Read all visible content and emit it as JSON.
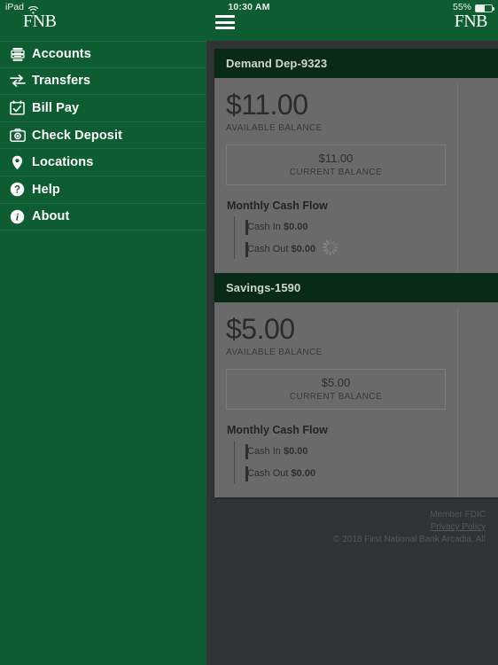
{
  "status_bar": {
    "device": "iPad",
    "wifi_icon": "wifi-icon",
    "time": "10:30 AM",
    "battery_percent": "55%",
    "battery_icon": "battery-icon"
  },
  "brand": {
    "logo_text": "FNB",
    "primary_green": "#0d5c32",
    "header_dark_green": "#0a2a19",
    "page_background": "#323335",
    "card_background": "#6a6a6a"
  },
  "nav": {
    "menu_icon": "hamburger-menu-icon",
    "logo_text": "FNB"
  },
  "drawer": {
    "logo_text": "FNB",
    "items": [
      {
        "label": "Accounts",
        "icon": "accounts-icon"
      },
      {
        "label": "Transfers",
        "icon": "transfers-icon"
      },
      {
        "label": "Bill Pay",
        "icon": "bill-pay-icon"
      },
      {
        "label": "Check Deposit",
        "icon": "check-deposit-icon"
      },
      {
        "label": "Locations",
        "icon": "locations-pin-icon"
      },
      {
        "label": "Help",
        "icon": "help-question-icon"
      },
      {
        "label": "About",
        "icon": "about-info-icon"
      }
    ]
  },
  "accounts": [
    {
      "title": "Demand Dep-9323",
      "available_amount": "$11.00",
      "available_label": "AVAILABLE BALANCE",
      "current_amount": "$11.00",
      "current_label": "CURRENT BALANCE",
      "cash_flow_title": "Monthly Cash Flow",
      "cash_in_label": "Cash In",
      "cash_in_value": "$0.00",
      "cash_out_label": "Cash Out",
      "cash_out_value": "$0.00",
      "loading_icon": "activity-spinner-icon"
    },
    {
      "title": "Savings-1590",
      "available_amount": "$5.00",
      "available_label": "AVAILABLE BALANCE",
      "current_amount": "$5.00",
      "current_label": "CURRENT BALANCE",
      "cash_flow_title": "Monthly Cash Flow",
      "cash_in_label": "Cash In",
      "cash_in_value": "$0.00",
      "cash_out_label": "Cash Out",
      "cash_out_value": "$0.00",
      "loading_icon": null
    }
  ],
  "footer": {
    "fdic": "Member FDIC",
    "privacy_policy": "Privacy Policy",
    "copyright": "© 2018 First National Bank Arcadia. All"
  }
}
